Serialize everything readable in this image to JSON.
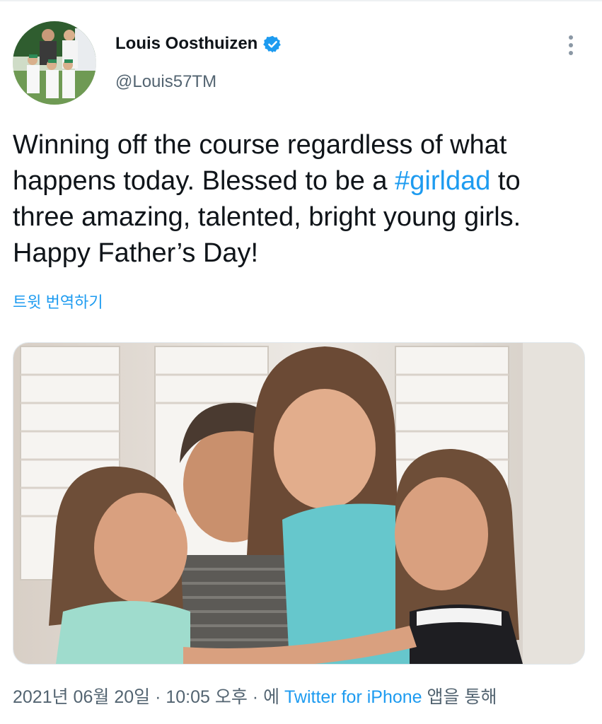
{
  "author": {
    "name": "Louis Oosthuizen",
    "handle": "@Louis57TM",
    "verified": true
  },
  "tweet": {
    "text_before": "Winning off the course regardless of what happens today. Blessed to be a ",
    "hashtag": "#girldad",
    "text_after": " to three amazing, talented, bright young girls. Happy Father’s Day!",
    "translate_label": "트윗 번역하기"
  },
  "meta": {
    "date": "2021년 06월 20일",
    "sep1": " · ",
    "time": "10:05 오후",
    "sep2": " · 에 ",
    "source": "Twitter for iPhone",
    "suffix": " 앱을 통해"
  },
  "icons": {
    "verified": "verified-badge-icon",
    "more": "more-options-icon"
  },
  "colors": {
    "link": "#1d9bf0",
    "secondary": "#536471",
    "text": "#0f1419"
  }
}
